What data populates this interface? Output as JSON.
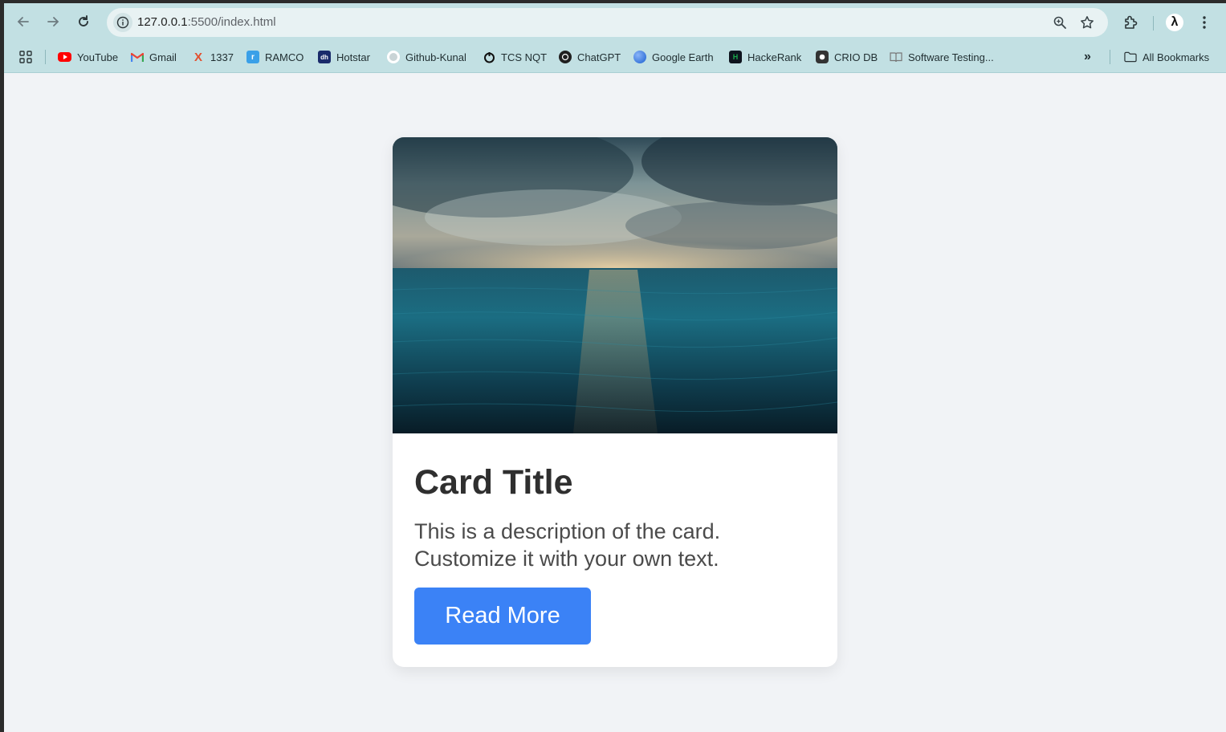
{
  "browser": {
    "url_host": "127.0.0.1",
    "url_path": ":5500/index.html",
    "toolbar_icons": [
      "back-arrow-icon",
      "forward-arrow-icon",
      "reload-icon",
      "site-info-icon",
      "zoom-icon",
      "star-icon",
      "extensions-icon",
      "profile-avatar",
      "kebab-menu-icon"
    ],
    "profile_initial": "λ"
  },
  "bookmarks": {
    "items": [
      {
        "label": "YouTube",
        "icon": "youtube-icon",
        "color": "#ff0000"
      },
      {
        "label": "Gmail",
        "icon": "gmail-icon",
        "color": "#ea4335"
      },
      {
        "label": "1337",
        "icon": "x-icon",
        "color": "#e2502f"
      },
      {
        "label": "RAMCO",
        "icon": "ramco-icon",
        "color": "#3aa0e8"
      },
      {
        "label": "Hotstar",
        "icon": "hotstar-icon",
        "color": "#1a2b6b"
      },
      {
        "label": "Github-Kunal",
        "icon": "github-icon",
        "color": "#ffffff"
      },
      {
        "label": "TCS NQT",
        "icon": "tcs-icon",
        "color": "#111111"
      },
      {
        "label": "ChatGPT",
        "icon": "chatgpt-icon",
        "color": "#202020"
      },
      {
        "label": "Google Earth",
        "icon": "google-earth-icon",
        "color": "#4285f4"
      },
      {
        "label": "HackeRank",
        "icon": "hackerrank-icon",
        "color": "#0e141e"
      },
      {
        "label": "CRIO DB",
        "icon": "crio-icon",
        "color": "#333333"
      },
      {
        "label": "Software Testing...",
        "icon": "book-icon",
        "color": "#888888"
      }
    ],
    "overflow_label": "»",
    "all_bookmarks_label": "All Bookmarks"
  },
  "card": {
    "title": "Card Title",
    "description": "This is a description of the card. Customize it with your own text.",
    "button_label": "Read More",
    "button_color": "#3b82f6"
  }
}
